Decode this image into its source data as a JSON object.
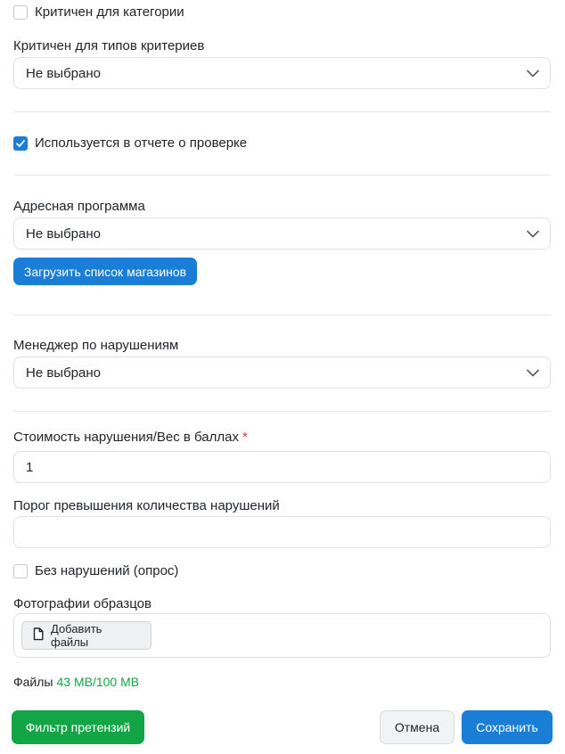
{
  "critical_category": {
    "label": "Критичен для категории",
    "checked": false
  },
  "critical_criteria_types": {
    "label": "Критичен для типов критериев",
    "value": "Не выбрано"
  },
  "used_in_report": {
    "label": "Используется в отчете о проверке",
    "checked": true
  },
  "address_program": {
    "label": "Адресная программа",
    "value": "Не выбрано",
    "load_button": "Загрузить список магазинов"
  },
  "violation_manager": {
    "label": "Менеджер по нарушениям",
    "value": "Не выбрано"
  },
  "violation_cost": {
    "label": "Стоимость нарушения/Вес в баллах",
    "required_mark": "*",
    "value": "1"
  },
  "violation_threshold": {
    "label": "Порог превышения количества нарушений",
    "value": ""
  },
  "no_violations": {
    "label": "Без нарушений (опрос)",
    "checked": false
  },
  "sample_photos": {
    "label": "Фотографии образцов",
    "add_files_button": "Добавить файлы"
  },
  "files": {
    "label": "Файлы",
    "size": "43 MB/100 MB"
  },
  "footer": {
    "claims_filter_button": "Фильтр претензий",
    "cancel_button": "Отмена",
    "save_button": "Сохранить"
  },
  "colors": {
    "primary": "#1a7ed6",
    "success": "#12a546",
    "danger": "#dc3545"
  }
}
